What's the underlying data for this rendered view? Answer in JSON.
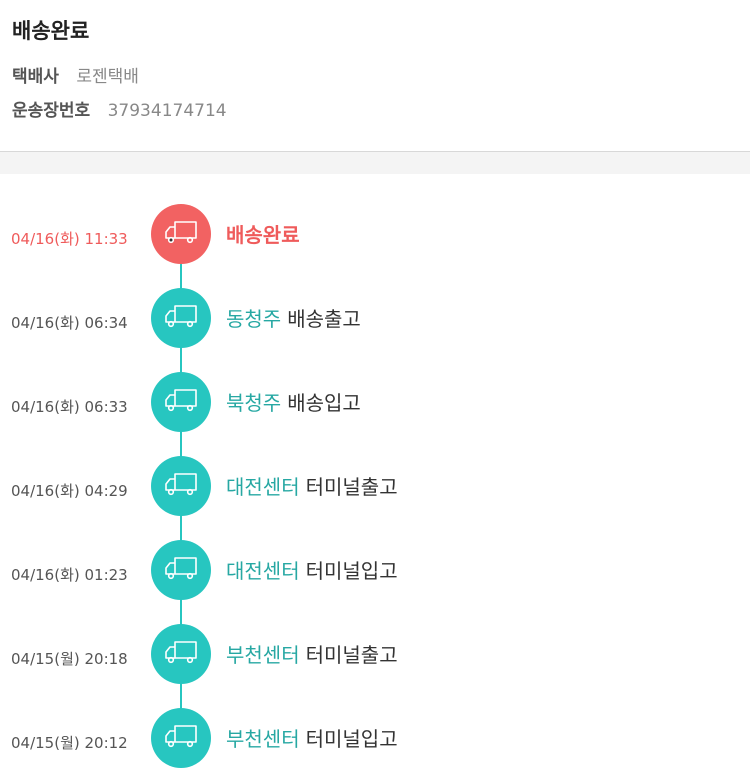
{
  "header": {
    "status_title": "배송완료",
    "courier_label": "택배사",
    "courier_value": "로젠택배",
    "waybill_label": "운송장번호",
    "waybill_value": "37934174714"
  },
  "events": [
    {
      "time": "04/16(화) 11:33",
      "location": "",
      "action": "배송완료"
    },
    {
      "time": "04/16(화) 06:34",
      "location": "동청주",
      "action": "배송출고"
    },
    {
      "time": "04/16(화) 06:33",
      "location": "북청주",
      "action": "배송입고"
    },
    {
      "time": "04/16(화) 04:29",
      "location": "대전센터",
      "action": "터미널출고"
    },
    {
      "time": "04/16(화) 01:23",
      "location": "대전센터",
      "action": "터미널입고"
    },
    {
      "time": "04/15(월) 20:18",
      "location": "부천센터",
      "action": "터미널출고"
    },
    {
      "time": "04/15(월) 20:12",
      "location": "부천센터",
      "action": "터미널입고"
    }
  ],
  "colors": {
    "accent_teal": "#27c6c0",
    "accent_red": "#f26262",
    "location_text": "#27a8a3"
  },
  "icons": {
    "node": "truck-icon"
  }
}
